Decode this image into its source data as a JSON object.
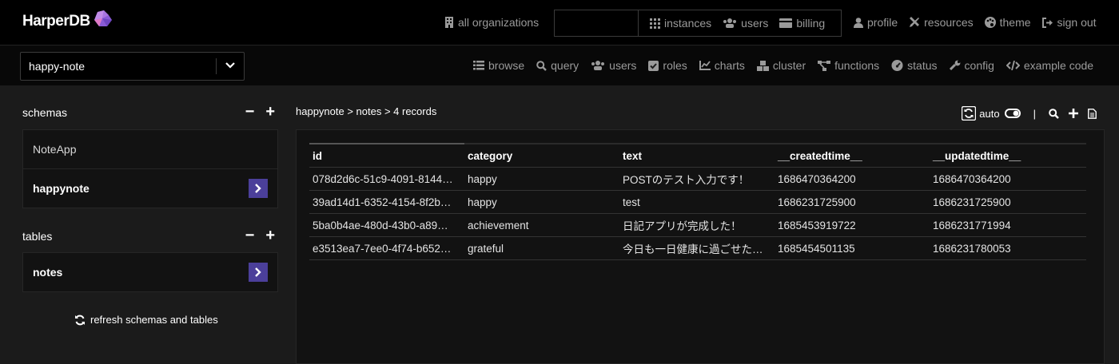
{
  "app": {
    "logo_text": "HarperDB"
  },
  "top_nav": {
    "all_organizations": "all organizations",
    "instances": "instances",
    "users": "users",
    "billing": "billing",
    "profile": "profile",
    "resources": "resources",
    "theme": "theme",
    "sign_out": "sign out"
  },
  "instance_select": {
    "value": "happy-note"
  },
  "sub_nav": {
    "browse": "browse",
    "query": "query",
    "users": "users",
    "roles": "roles",
    "charts": "charts",
    "cluster": "cluster",
    "functions": "functions",
    "status": "status",
    "config": "config",
    "example_code": "example code"
  },
  "sidebar": {
    "schemas_title": "schemas",
    "schemas": [
      {
        "label": "NoteApp",
        "selected": false
      },
      {
        "label": "happynote",
        "selected": true
      }
    ],
    "tables_title": "tables",
    "tables": [
      {
        "label": "notes",
        "selected": true
      }
    ],
    "refresh_label": "refresh schemas and tables",
    "minus": "−",
    "plus": "+"
  },
  "main": {
    "breadcrumb": "happynote > notes > 4 records",
    "auto_label": "auto",
    "separator": "|"
  },
  "table": {
    "columns": [
      "id",
      "category",
      "text",
      "__createdtime__",
      "__updatedtime__"
    ],
    "rows": [
      [
        "078d2d6c-51c9-4091-8144…",
        "happy",
        "POSTのテスト入力です！",
        "1686470364200",
        "1686470364200"
      ],
      [
        "39ad14d1-6352-4154-8f2b…",
        "happy",
        "test",
        "1686231725900",
        "1686231725900"
      ],
      [
        "5ba0b4ae-480d-43b0-a89…",
        "achievement",
        "日記アプリが完成した！",
        "1685453919722",
        "1686231771994"
      ],
      [
        "e3513ea7-7ee0-4f74-b652…",
        "grateful",
        "今日も一日健康に過ごせた…",
        "1685454501135",
        "1686231780053"
      ]
    ]
  },
  "colors": {
    "accent": "#4b3f9a",
    "background": "#1b1b1b",
    "topbar": "#000000"
  }
}
